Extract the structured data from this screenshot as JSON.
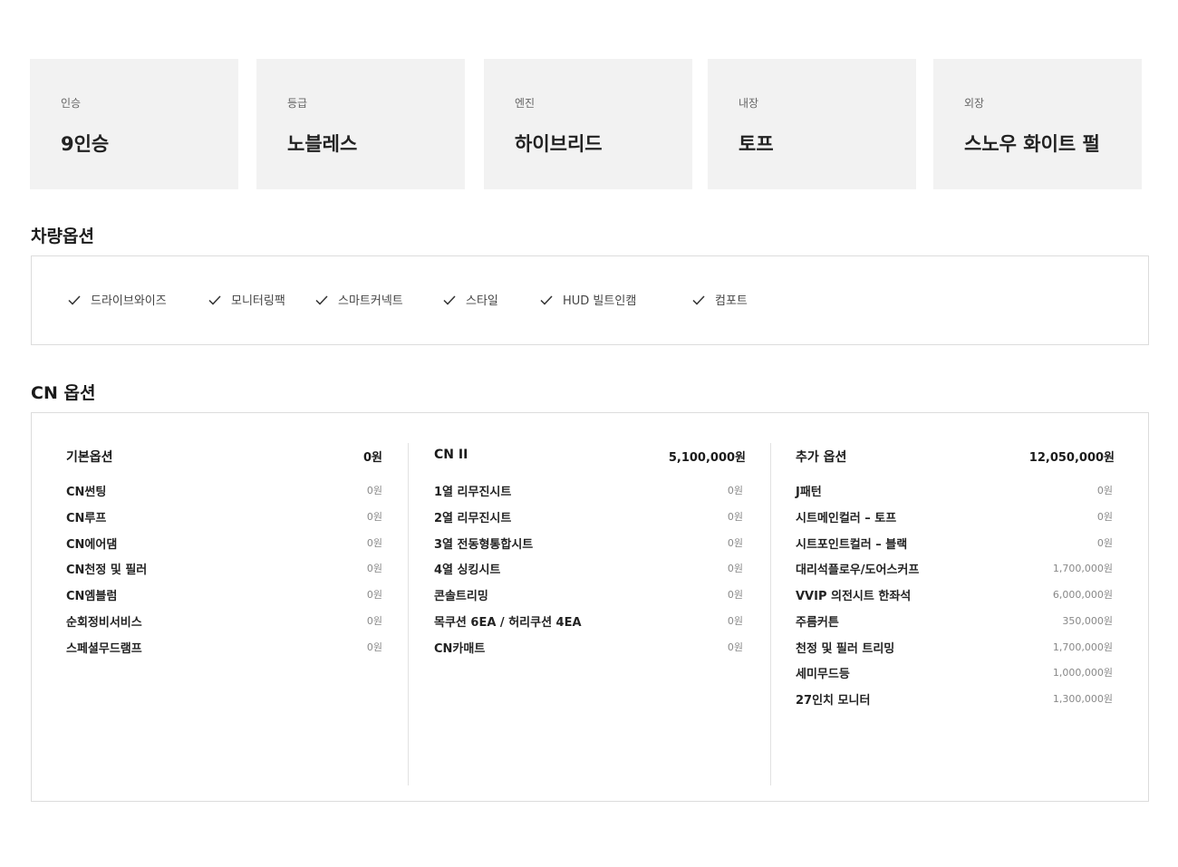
{
  "specs": [
    {
      "label": "인승",
      "value": "9인승"
    },
    {
      "label": "등급",
      "value": "노블레스"
    },
    {
      "label": "엔진",
      "value": "하이브리드"
    },
    {
      "label": "내장",
      "value": "토프"
    },
    {
      "label": "외장",
      "value": "스노우 화이트 펄"
    }
  ],
  "vehicle_options": {
    "title": "차량옵션",
    "items": [
      "드라이브와이즈",
      "모니터링팩",
      "스마트커넥트",
      "스타일",
      "HUD 빌트인캠",
      "컴포트"
    ]
  },
  "cn_options": {
    "title": "CN 옵션",
    "columns": [
      {
        "title": "기본옵션",
        "total": "0원",
        "rows": [
          {
            "name": "CN썬팅",
            "price": "0원"
          },
          {
            "name": "CN루프",
            "price": "0원"
          },
          {
            "name": "CN에어댐",
            "price": "0원"
          },
          {
            "name": "CN천정 및 필러",
            "price": "0원"
          },
          {
            "name": "CN엠블럼",
            "price": "0원"
          },
          {
            "name": "순회정비서비스",
            "price": "0원"
          },
          {
            "name": "스페셜무드램프",
            "price": "0원"
          }
        ]
      },
      {
        "title": "CN II",
        "total": "5,100,000원",
        "rows": [
          {
            "name": "1열 리무진시트",
            "price": "0원"
          },
          {
            "name": "2열 리무진시트",
            "price": "0원"
          },
          {
            "name": "3열 전동형통합시트",
            "price": "0원"
          },
          {
            "name": "4열 싱킹시트",
            "price": "0원"
          },
          {
            "name": "콘솔트리밍",
            "price": "0원"
          },
          {
            "name": "목쿠션 6EA / 허리쿠션 4EA",
            "price": "0원"
          },
          {
            "name": "CN카매트",
            "price": "0원"
          }
        ]
      },
      {
        "title": "추가 옵션",
        "total": "12,050,000원",
        "rows": [
          {
            "name": "J패턴",
            "price": "0원"
          },
          {
            "name": "시트메인컬러 – 토프",
            "price": "0원"
          },
          {
            "name": "시트포인트컬러 – 블랙",
            "price": "0원"
          },
          {
            "name": "대리석플로우/도어스커프",
            "price": "1,700,000원"
          },
          {
            "name": "VVIP 의전시트 한좌석",
            "price": "6,000,000원"
          },
          {
            "name": "주름커튼",
            "price": "350,000원"
          },
          {
            "name": "천정 및 필러 트리밍",
            "price": "1,700,000원"
          },
          {
            "name": "세미무드등",
            "price": "1,000,000원"
          },
          {
            "name": "27인치 모니터",
            "price": "1,300,000원"
          }
        ]
      }
    ]
  }
}
